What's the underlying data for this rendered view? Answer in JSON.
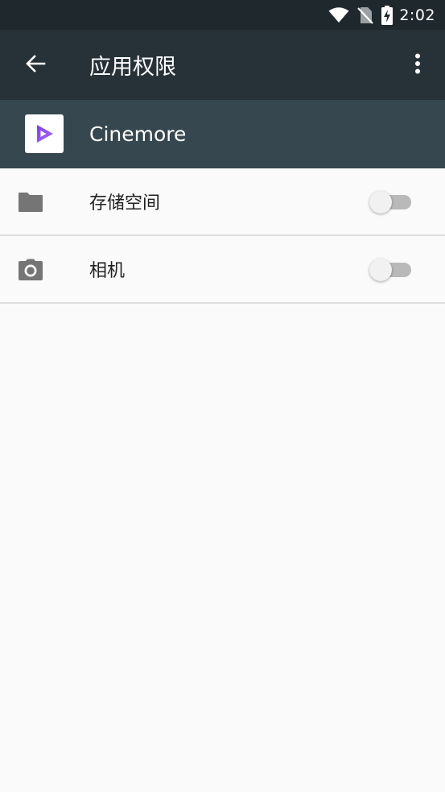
{
  "status_bar": {
    "time": "2:02",
    "icons": [
      "wifi-icon",
      "no-sim-icon",
      "battery-charging-icon"
    ]
  },
  "app_bar": {
    "title": "应用权限",
    "back_icon": "arrow-back-icon",
    "more_icon": "more-vert-icon",
    "background": "#263238"
  },
  "app_header": {
    "app_name": "Cinemore",
    "app_icon": "cinemore-play-icon",
    "background": "#37474f",
    "icon_color": "#8e4fe3"
  },
  "permissions": [
    {
      "label": "存储空间",
      "icon": "folder-icon",
      "enabled": false
    },
    {
      "label": "相机",
      "icon": "camera-icon",
      "enabled": false
    }
  ]
}
